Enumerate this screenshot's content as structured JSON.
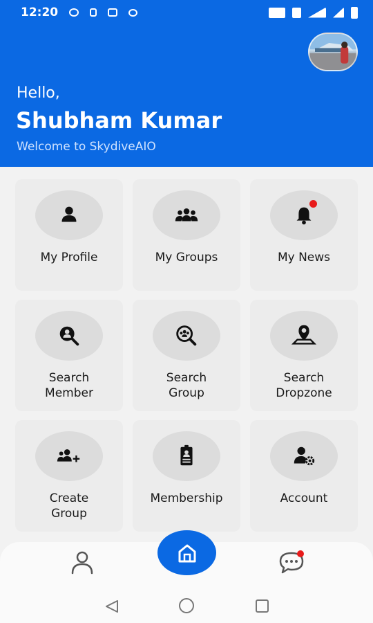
{
  "status_bar": {
    "time": "12:20",
    "icons": [
      "message-icon",
      "sim-icon",
      "image-icon",
      "chat-bubble-icon",
      "volte-icon",
      "vibrate-icon",
      "4g-signal-icon",
      "signal-icon",
      "battery-icon"
    ]
  },
  "header": {
    "greeting": "Hello,",
    "user_name": "Shubham Kumar",
    "welcome": "Welcome to SkydiveAIO"
  },
  "menu": {
    "items": [
      {
        "label": "My Profile",
        "icon": "user-icon"
      },
      {
        "label": "My Groups",
        "icon": "group-icon"
      },
      {
        "label": "My News",
        "icon": "bell-icon",
        "badge": true
      },
      {
        "label": "Search\nMember",
        "icon": "search-member-icon"
      },
      {
        "label": "Search\nGroup",
        "icon": "search-group-icon"
      },
      {
        "label": "Search\nDropzone",
        "icon": "map-pin-icon"
      },
      {
        "label": "Create\nGroup",
        "icon": "add-group-icon"
      },
      {
        "label": "Membership",
        "icon": "id-badge-icon"
      },
      {
        "label": "Account",
        "icon": "user-settings-icon"
      }
    ]
  },
  "bottom_nav": {
    "items": [
      "profile-icon",
      "home-icon",
      "chat-icon"
    ],
    "chat_badge": true
  },
  "colors": {
    "primary": "#0b69e3",
    "badge": "#e81b1b",
    "card": "#ececec"
  }
}
